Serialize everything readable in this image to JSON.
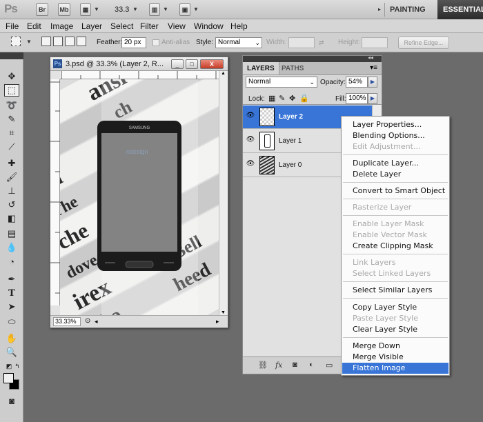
{
  "app": {
    "logo": "Ps",
    "bridge_label": "Br",
    "minibridge_label": "Mb",
    "zoom": "33.3",
    "workspaces": {
      "painting": "PAINTING",
      "essentials": "ESSENTIALS"
    }
  },
  "menu": [
    "File",
    "Edit",
    "Image",
    "Layer",
    "Select",
    "Filter",
    "View",
    "Window",
    "Help"
  ],
  "options": {
    "feather_label": "Feather:",
    "feather_value": "20 px",
    "antialias_label": "Anti-alias",
    "style_label": "Style:",
    "style_value": "Normal",
    "width_label": "Width:",
    "height_label": "Height:",
    "refine_edge": "Refine Edge..."
  },
  "document": {
    "title": "3.psd @ 33.3% (Layer 2, R...",
    "zoom_status": "33.33%",
    "phone_brand": "SAMSUNG",
    "win_buttons": {
      "minimize": "_",
      "maximize": "□",
      "close": "X"
    }
  },
  "layers_panel": {
    "tabs": [
      "LAYERS",
      "PATHS"
    ],
    "blend_mode": "Normal",
    "opacity_label": "Opacity:",
    "opacity_value": "54%",
    "lock_label": "Lock:",
    "fill_label": "Fill:",
    "fill_value": "100%",
    "layers": [
      {
        "name": "Layer 2",
        "selected": true
      },
      {
        "name": "Layer 1",
        "selected": false
      },
      {
        "name": "Layer 0",
        "selected": false
      }
    ]
  },
  "context_menu": {
    "groups": [
      [
        {
          "label": "Layer Properties...",
          "enabled": true
        },
        {
          "label": "Blending Options...",
          "enabled": true
        },
        {
          "label": "Edit Adjustment...",
          "enabled": false
        }
      ],
      [
        {
          "label": "Duplicate Layer...",
          "enabled": true
        },
        {
          "label": "Delete Layer",
          "enabled": true
        }
      ],
      [
        {
          "label": "Convert to Smart Object",
          "enabled": true
        }
      ],
      [
        {
          "label": "Rasterize Layer",
          "enabled": false
        }
      ],
      [
        {
          "label": "Enable Layer Mask",
          "enabled": false
        },
        {
          "label": "Enable Vector Mask",
          "enabled": false
        },
        {
          "label": "Create Clipping Mask",
          "enabled": true
        }
      ],
      [
        {
          "label": "Link Layers",
          "enabled": false
        },
        {
          "label": "Select Linked Layers",
          "enabled": false
        }
      ],
      [
        {
          "label": "Select Similar Layers",
          "enabled": true
        }
      ],
      [
        {
          "label": "Copy Layer Style",
          "enabled": true
        },
        {
          "label": "Paste Layer Style",
          "enabled": false
        },
        {
          "label": "Clear Layer Style",
          "enabled": true
        }
      ],
      [
        {
          "label": "Merge Down",
          "enabled": true
        },
        {
          "label": "Merge Visible",
          "enabled": true
        },
        {
          "label": "Flatten Image",
          "enabled": true,
          "highlighted": true
        }
      ]
    ]
  },
  "colors": {
    "selection_blue": "#3875d7",
    "foreground": "#f0f0f0",
    "background": "#000000"
  }
}
